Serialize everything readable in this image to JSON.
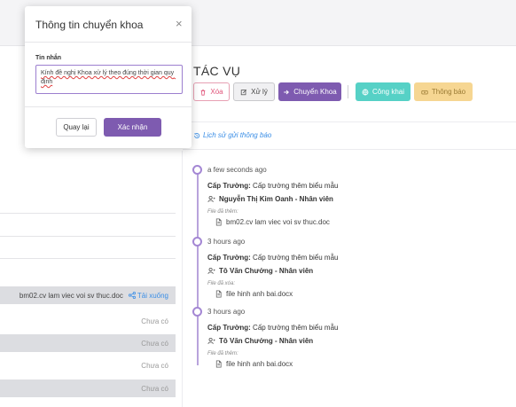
{
  "section_title": "TÁC VỤ",
  "actions": {
    "delete": "Xóa",
    "process": "Xử lý",
    "transfer": "Chuyển Khoa",
    "public": "Công khai",
    "notify": "Thông báo"
  },
  "history_link": "Lịch sử gửi thông báo",
  "timeline": [
    {
      "time": "a few seconds ago",
      "actor": "Cấp Trường:",
      "action": "Cấp trường thêm biểu mẫu",
      "person": "Nguyễn Thị Kim Oanh - Nhân viên",
      "file_label": "File đã thêm:",
      "file": "bm02.cv lam viec voi sv thuc.doc"
    },
    {
      "time": "3 hours ago",
      "actor": "Cấp Trường:",
      "action": "Cấp trường thêm biểu mẫu",
      "person": "Tô Văn Chưởng - Nhân viên",
      "file_label": "File đã xóa:",
      "file": "file hinh anh bai.docx"
    },
    {
      "time": "3 hours ago",
      "actor": "Cấp Trường:",
      "action": "Cấp trường thêm biểu mẫu",
      "person": "Tô Văn Chưởng - Nhân viên",
      "file_label": "File đã thêm:",
      "file": "file hinh anh bai.docx"
    }
  ],
  "left_table": {
    "file_row": {
      "file": "bm02.cv lam viec voi sv thuc.doc",
      "download": "Tải xuống"
    },
    "status_rows": [
      "Chưa có",
      "Chưa có",
      "Chưa có",
      "Chưa có"
    ]
  },
  "modal": {
    "title": "Thông tin chuyển khoa",
    "close": "×",
    "field_label": "Tin nhắn",
    "message": "Kính đề nghị Khoa xử lý theo đúng thời gian quy định",
    "back": "Quay lại",
    "confirm": "Xác nhận"
  },
  "colors": {
    "purple": "#7e5bb0",
    "teal": "#56d1c6",
    "amber": "#f6d692",
    "pink": "#e0557a",
    "link": "#3a8ee6"
  }
}
